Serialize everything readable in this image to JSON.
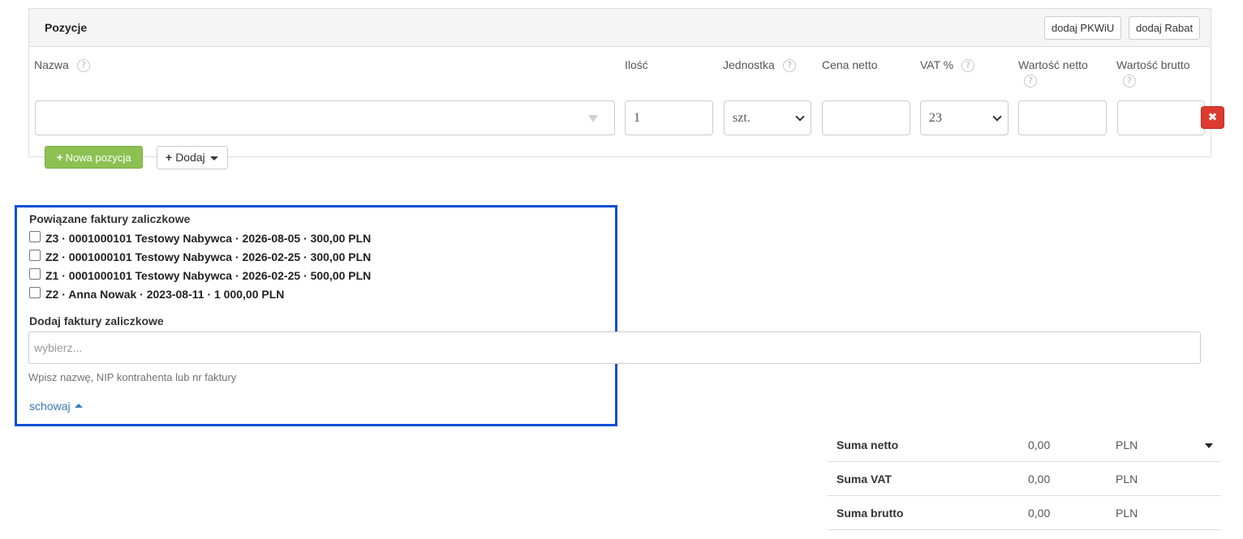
{
  "positions": {
    "title": "Pozycje",
    "add_pkwiu": "dodaj PKWiU",
    "add_discount": "dodaj Rabat",
    "help_symbol": "?",
    "columns": {
      "name": "Nazwa",
      "qty": "Ilość",
      "unit": "Jednostka",
      "net_price": "Cena netto",
      "vat": "VAT %",
      "net_value": "Wartość netto",
      "gross_value": "Wartość brutto"
    },
    "row": {
      "name": "",
      "qty": "1",
      "unit": "szt.",
      "net_price": "",
      "vat": "23",
      "net_value": "",
      "gross_value": ""
    },
    "delete_symbol": "✖",
    "new_item": "Nowa pozycja",
    "add_menu": "Dodaj"
  },
  "advances": {
    "title": "Powiązane faktury zaliczkowe",
    "items": [
      {
        "label": "Z3 · 0001000101 Testowy Nabywca · 2026-08-05 · 300,00 PLN",
        "checked": false
      },
      {
        "label": "Z2 · 0001000101 Testowy Nabywca · 2026-02-25 · 300,00 PLN",
        "checked": false
      },
      {
        "label": "Z1 · 0001000101 Testowy Nabywca · 2026-02-25 · 500,00 PLN",
        "checked": false
      },
      {
        "label": "Z2 · Anna Nowak · 2023-08-11 · 1 000,00 PLN",
        "checked": false
      }
    ],
    "add_title": "Dodaj faktury zaliczkowe",
    "search_placeholder": "wybierz...",
    "hint": "Wpisz nazwę, NIP kontrahenta lub nr faktury",
    "hide_link": "schowaj"
  },
  "totals": [
    {
      "label": "Suma netto",
      "value": "0,00",
      "currency": "PLN"
    },
    {
      "label": "Suma VAT",
      "value": "0,00",
      "currency": "PLN"
    },
    {
      "label": "Suma brutto",
      "value": "0,00",
      "currency": "PLN"
    }
  ],
  "colors": {
    "highlight_border": "#0b4fd6",
    "add_button_green": "#8cc152",
    "delete_red": "#dd3b2f",
    "link_blue": "#337ab7"
  }
}
